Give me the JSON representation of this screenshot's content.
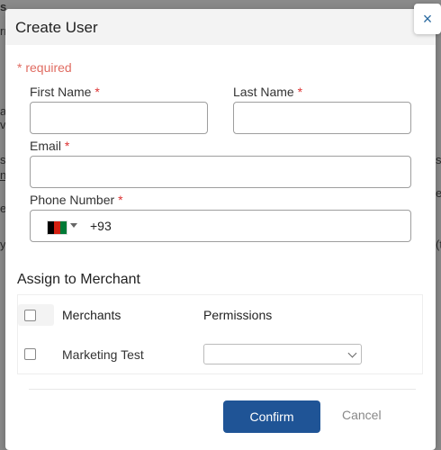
{
  "background": {
    "fragments": [
      "s",
      "rr",
      "a",
      "v",
      "se",
      "n",
      "ec",
      "y",
      "si",
      "e",
      "(t"
    ]
  },
  "modal": {
    "title": "Create User",
    "close_icon": "×",
    "required_note": "* required",
    "fields": {
      "first_name": {
        "label": "First Name",
        "value": "",
        "placeholder": ""
      },
      "last_name": {
        "label": "Last Name",
        "value": "",
        "placeholder": ""
      },
      "email": {
        "label": "Email",
        "value": "",
        "placeholder": ""
      },
      "phone": {
        "label": "Phone Number",
        "dial_code": "+93",
        "country": "Afghanistan",
        "value": ""
      }
    },
    "required_star": "*",
    "section": {
      "title": "Assign to Merchant",
      "columns": [
        "Merchants",
        "Permissions"
      ],
      "rows": [
        {
          "merchant": "Marketing Test",
          "permission": ""
        }
      ]
    },
    "buttons": {
      "confirm": "Confirm",
      "cancel": "Cancel"
    }
  },
  "colors": {
    "primary": "#1f5496",
    "required": "#e06c62",
    "star": "#dd3333",
    "flag_black": "#000000",
    "flag_red": "#d32011",
    "flag_green": "#007a36"
  }
}
